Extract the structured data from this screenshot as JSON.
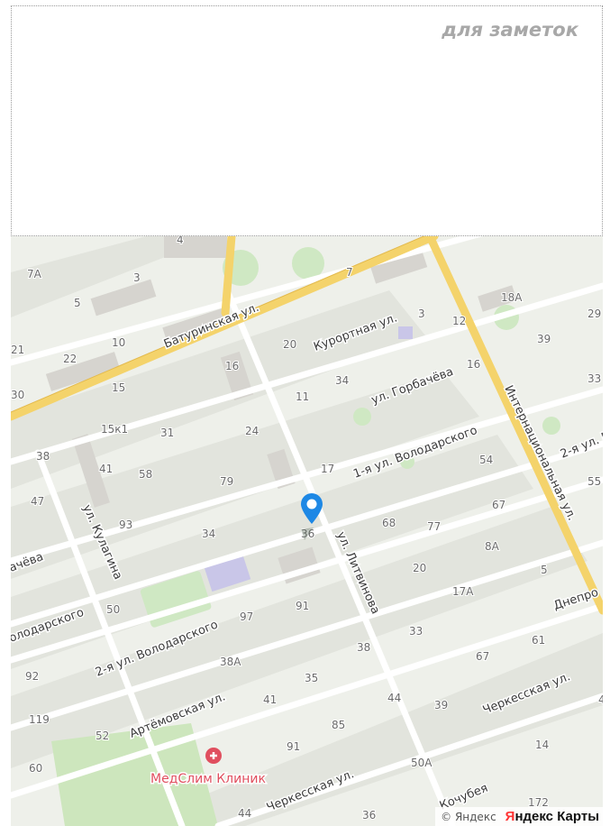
{
  "notes": {
    "label": "для заметок"
  },
  "map": {
    "streets": {
      "baturinskaya": "Батуринская ул.",
      "kurortnaya": "Курортная ул.",
      "gorbacheva": "ул. Горбачёва",
      "volodarskogo1": "1-я ул. Володарского",
      "volodarskogo2": "2-я ул. Володарского",
      "volodarskogo2_right": "2-я ул. В",
      "internatsionalnaya": "Интернациональная ул.",
      "litvinova": "ул. Литвинова",
      "kulagina": "ул. Кулагина",
      "artemovskaya": "Артёмовская ул.",
      "cherkesskaya": "Черкесская ул.",
      "cherkesskaya_right": "Черкесская ул.",
      "gorbacheva_left": "ачёва",
      "volodarskogo_left": "олодарского",
      "dneprovskaya": "Днепро",
      "kochubeya": "Кочубея"
    },
    "house_numbers": [
      "7А",
      "3",
      "5",
      "4",
      "7",
      "18А",
      "29",
      "21",
      "22",
      "10",
      "3",
      "12",
      "39",
      "30",
      "15",
      "16",
      "20",
      "16",
      "33",
      "11",
      "34",
      "38",
      "15к1",
      "31",
      "24",
      "17",
      "54",
      "55",
      "41",
      "58",
      "79",
      "47",
      "93",
      "34",
      "68",
      "77",
      "67",
      "36",
      "8А",
      "20",
      "5",
      "50",
      "97",
      "91",
      "17А",
      "92",
      "33",
      "61",
      "38А",
      "38",
      "67",
      "119",
      "35",
      "41",
      "44",
      "39",
      "52",
      "85",
      "60",
      "91",
      "14",
      "50А",
      "44",
      "36",
      "172",
      "4"
    ],
    "poi": {
      "name": "МедСлим Клиник",
      "color": "#e04f5f"
    },
    "marker": {
      "color": "#1e88e5"
    },
    "attribution": {
      "copyright": "© Яндекс",
      "brand_y": "Я",
      "brand_rest": "ндекс Карты"
    }
  }
}
